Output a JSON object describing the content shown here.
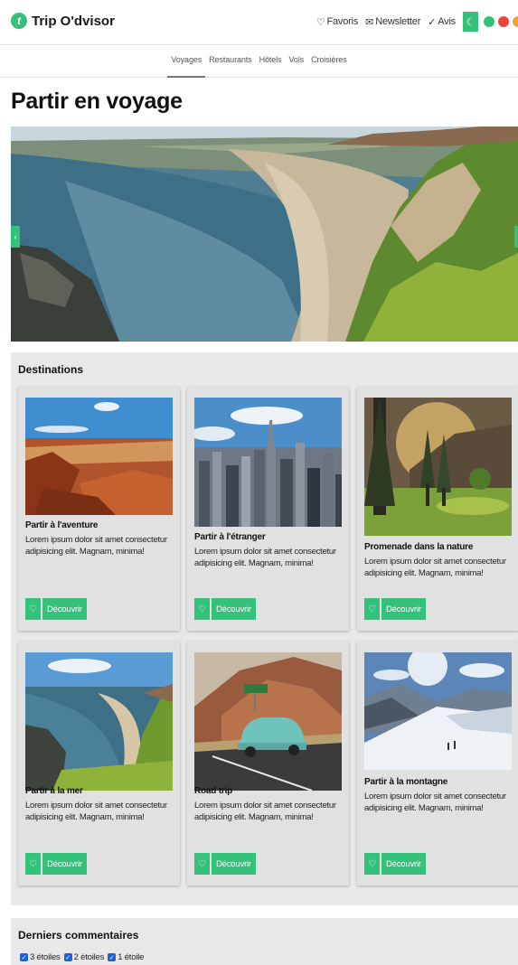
{
  "header": {
    "logo_letter": "t",
    "brand": "Trip O'dvisor",
    "links": [
      {
        "icon": "heart-icon",
        "label": "Favoris"
      },
      {
        "icon": "mail-icon",
        "label": "Newsletter"
      },
      {
        "icon": "check-badge-icon",
        "label": "Avis"
      }
    ],
    "theme_icon": "moon-icon",
    "accent_color": "#34c17a"
  },
  "nav": {
    "items": [
      "Voyages",
      "Restaurants",
      "Hôtels",
      "Vols",
      "Croisières"
    ],
    "active": "Voyages"
  },
  "page": {
    "title": "Partir en voyage"
  },
  "hero": {
    "image": "coastal beach and green cliffs",
    "prev_icon": "chevron-left-icon"
  },
  "destinations": {
    "title": "Destinations",
    "button_label": "Découvrir",
    "cards": [
      {
        "title": "Partir à l'aventure",
        "text": "Lorem ipsum dolor sit amet consectetur adipisicing elit. Magnam, minima!"
      },
      {
        "title": "Partir à l'étranger",
        "text": "Lorem ipsum dolor sit amet consectetur adipisicing elit. Magnam, minima!"
      },
      {
        "title": "Promenade dans la nature",
        "text": "Lorem ipsum dolor sit amet consectetur adipisicing elit. Magnam, minima!"
      },
      {
        "title": "Partir à la mer",
        "text": "Lorem ipsum dolor sit amet consectetur adipisicing elit. Magnam, minima!"
      },
      {
        "title": "Road trip",
        "text": "Lorem ipsum dolor sit amet consectetur adipisicing elit. Magnam, minima!"
      },
      {
        "title": "Partir à la montagne",
        "text": "Lorem ipsum dolor sit amet consectetur adipisicing elit. Magnam, minima!"
      }
    ]
  },
  "comments": {
    "title": "Derniers commentaires",
    "filters": [
      "3 étoiles",
      "2 étoiles",
      "1 étoile"
    ]
  }
}
